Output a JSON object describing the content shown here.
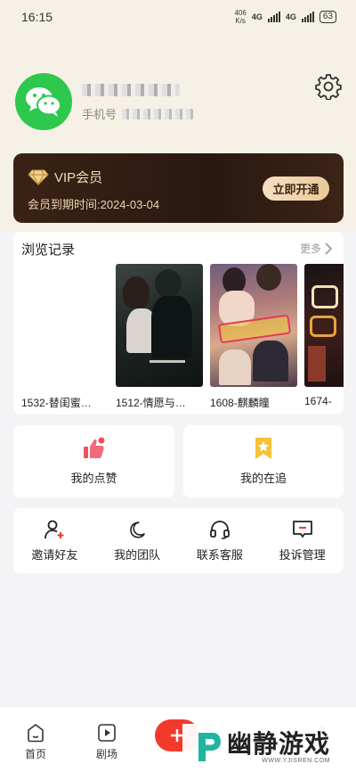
{
  "status_bar": {
    "time": "16:15",
    "net_speed_value": "406",
    "net_speed_unit": "K/s",
    "sim1": "4G",
    "sim2": "4G",
    "battery": "63"
  },
  "profile": {
    "phone_label": "手机号"
  },
  "vip": {
    "title": "VIP会员",
    "expire_text": "会员到期时间:2024-03-04",
    "open_button": "立即开通"
  },
  "history": {
    "title": "浏览记录",
    "more": "更多",
    "items": [
      {
        "label": "1532-替闺蜜…"
      },
      {
        "label": "1512-情愿与…"
      },
      {
        "label": "1608-麒麟瞳"
      },
      {
        "label": "1674-"
      }
    ]
  },
  "features": {
    "likes": "我的点赞",
    "following": "我的在追"
  },
  "tools": {
    "invite": "邀请好友",
    "team": "我的团队",
    "support": "联系客服",
    "complaint": "投诉管理"
  },
  "tabbar": {
    "home": "首页",
    "theater": "剧场"
  },
  "watermark": {
    "brand": "幽静游戏",
    "url": "WWW.YJISREN.COM"
  },
  "colors": {
    "accent_red": "#f23a2c",
    "vip_gold": "#f2dcb8",
    "avatar_green": "#2dc84d"
  }
}
